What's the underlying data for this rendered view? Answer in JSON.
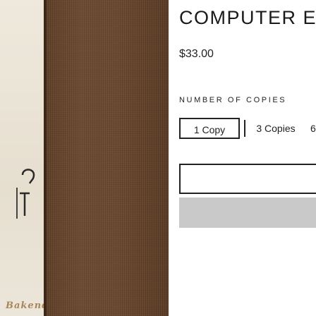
{
  "product": {
    "title": "COMPUTER EN",
    "price": "$33.00"
  },
  "image": {
    "caption": "Bakende",
    "icon": "hanger-icon"
  },
  "copies": {
    "label": "NUMBER OF COPIES",
    "options": [
      "1 Copy",
      "3 Copies",
      "6"
    ],
    "selected": "1 Copy"
  },
  "colors": {
    "accent": "#222222",
    "submit_bar": "#c9c9c9",
    "image_brown": "#6a472f"
  }
}
